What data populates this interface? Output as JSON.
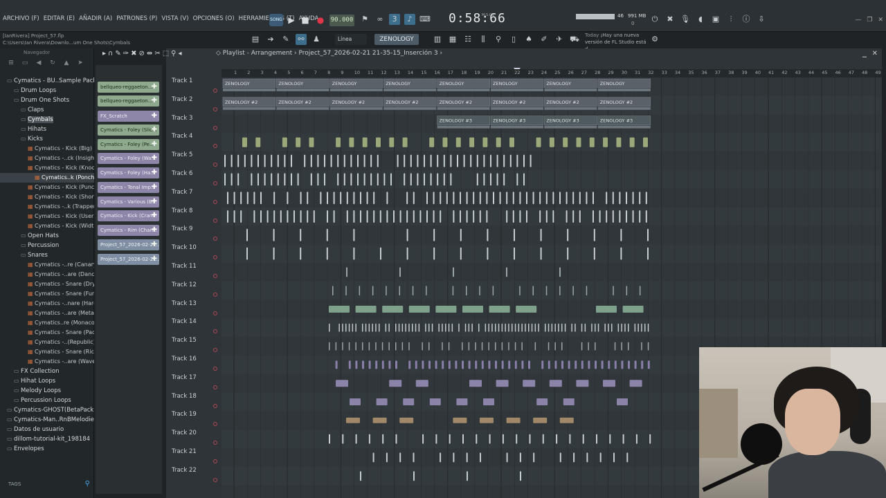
{
  "menu": [
    "ARCHIVO (F)",
    "EDITAR (E)",
    "AÑADIR (A)",
    "PATRONES (P)",
    "VISTA (V)",
    "OPCIONES (O)",
    "HERRAMIENTAS (T)",
    "AYUDA"
  ],
  "hint": {
    "line1": "[IanRivera] Project_57.flp",
    "line2": "C:\\Users\\Ian Rivera\\Downlo...um One Shots\\Cymbals"
  },
  "transport": {
    "song_label": "SONG",
    "tempo": "90.000",
    "time": "0:58:66",
    "time_sub": "M:S:CS"
  },
  "cpu": {
    "value": "46",
    "mem": "991 MB",
    "mem2": "0"
  },
  "toolbar": {
    "snap": "Línea",
    "pattern": "ZENOLOGY"
  },
  "news": {
    "today": "Today",
    "text": "¡Hay una nueva versión de FL Studio está d..."
  },
  "browser": {
    "header": "Navegador",
    "tree": [
      {
        "label": "Cymatics - BU..Sample Pack",
        "level": 0,
        "kind": "folder"
      },
      {
        "label": "Drum Loops",
        "level": 1,
        "kind": "folder"
      },
      {
        "label": "Drum One Shots",
        "level": 1,
        "kind": "folder"
      },
      {
        "label": "Claps",
        "level": 2,
        "kind": "folder"
      },
      {
        "label": "Cymbals",
        "level": 2,
        "kind": "folder",
        "selected": true
      },
      {
        "label": "Hihats",
        "level": 2,
        "kind": "folder"
      },
      {
        "label": "Kicks",
        "level": 2,
        "kind": "folder"
      },
      {
        "label": "Cymatics - Kick (Big)",
        "level": 3,
        "kind": "file"
      },
      {
        "label": "Cymatics -..ck (Insight)",
        "level": 3,
        "kind": "file"
      },
      {
        "label": "Cymatics - Kick (Knock)",
        "level": 3,
        "kind": "file"
      },
      {
        "label": "Cymatics..k (Ponche)",
        "level": 4,
        "kind": "file",
        "selected": true
      },
      {
        "label": "Cymatics - Kick (Punch)",
        "level": 3,
        "kind": "file"
      },
      {
        "label": "Cymatics - Kick (Short)",
        "level": 3,
        "kind": "file"
      },
      {
        "label": "Cymatics -..k (Trapper)",
        "level": 3,
        "kind": "file"
      },
      {
        "label": "Cymatics - Kick (User)",
        "level": 3,
        "kind": "file"
      },
      {
        "label": "Cymatics - Kick (Width)",
        "level": 3,
        "kind": "file"
      },
      {
        "label": "Open Hats",
        "level": 2,
        "kind": "folder"
      },
      {
        "label": "Percussion",
        "level": 2,
        "kind": "folder"
      },
      {
        "label": "Snares",
        "level": 2,
        "kind": "folder"
      },
      {
        "label": "Cymatics -..re (Canary)",
        "level": 3,
        "kind": "file"
      },
      {
        "label": "Cymatics -..are (Dance)",
        "level": 3,
        "kind": "file"
      },
      {
        "label": "Cymatics - Snare (Dry)",
        "level": 3,
        "kind": "file"
      },
      {
        "label": "Cymatics - Snare (Fun)",
        "level": 3,
        "kind": "file"
      },
      {
        "label": "Cymatics -..nare (Hard)",
        "level": 3,
        "kind": "file"
      },
      {
        "label": "Cymatics -..are (Metal)",
        "level": 3,
        "kind": "file"
      },
      {
        "label": "Cymatics..re (Monaco)",
        "level": 3,
        "kind": "file"
      },
      {
        "label": "Cymatics - Snare (Pack)",
        "level": 3,
        "kind": "file"
      },
      {
        "label": "Cymatics -..(Republic)",
        "level": 3,
        "kind": "file"
      },
      {
        "label": "Cymatics - Snare (Rico)",
        "level": 3,
        "kind": "file"
      },
      {
        "label": "Cymatics -..are (Waves)",
        "level": 3,
        "kind": "file"
      },
      {
        "label": "FX Collection",
        "level": 1,
        "kind": "folder"
      },
      {
        "label": "Hihat Loops",
        "level": 1,
        "kind": "folder"
      },
      {
        "label": "Melody Loops",
        "level": 1,
        "kind": "folder"
      },
      {
        "label": "Percussion Loops",
        "level": 1,
        "kind": "folder"
      },
      {
        "label": "Cymatics-GHOST(BetaPack)",
        "level": 0,
        "kind": "folder"
      },
      {
        "label": "Cymatics-Man..RnBMelodies",
        "level": 0,
        "kind": "folder"
      },
      {
        "label": "Datos de usuario",
        "level": 0,
        "kind": "folder"
      },
      {
        "label": "dillom-tutorial-kit_198184",
        "level": 0,
        "kind": "folder"
      },
      {
        "label": "Envelopes",
        "level": 0,
        "kind": "folder"
      }
    ],
    "footer": "TAGS"
  },
  "picker": [
    {
      "label": "bellqueo-reggaeton...",
      "color": "green"
    },
    {
      "label": "bellqueo-reggaeton...",
      "color": "green"
    },
    {
      "label": "FX_Scratch",
      "color": "purple"
    },
    {
      "label": "Cymatics - Foley (Slic...",
      "color": "green"
    },
    {
      "label": "Cymatics - Foley (Pe...",
      "color": "green"
    },
    {
      "label": "Cymatics - Foley (Wa...",
      "color": "purple"
    },
    {
      "label": "Cymatics - Foley (Ha...",
      "color": "purple"
    },
    {
      "label": "Cymatics - Tonal Imp...",
      "color": "purple"
    },
    {
      "label": "Cymatics - Various (B...",
      "color": "purple"
    },
    {
      "label": "Cymatics - Kick (Cran...",
      "color": "purple"
    },
    {
      "label": "Cymatics - Rim (Chan...",
      "color": "purple"
    },
    {
      "label": "Project_57_2026-02-21...",
      "color": "blue"
    },
    {
      "label": "Project_57_2026-02-21...",
      "color": "blue"
    }
  ],
  "playlist": {
    "title": "Playlist - Arrangement",
    "pattern": "Project_57_2026-02-21 21-35-15_Inserción 3",
    "bars": [
      "1",
      "2",
      "3",
      "4",
      "5",
      "6",
      "7",
      "8",
      "9",
      "10",
      "11",
      "12",
      "13",
      "14",
      "15",
      "16",
      "17",
      "18",
      "19",
      "20",
      "21",
      "22",
      "23",
      "24",
      "25",
      "26",
      "27",
      "28",
      "29",
      "30",
      "31",
      "32",
      "33",
      "34",
      "35",
      "36",
      "37",
      "38",
      "39",
      "40",
      "41",
      "42",
      "43",
      "44",
      "45",
      "46",
      "47",
      "48",
      "49"
    ],
    "tracks": [
      "Track 1",
      "Track 2",
      "Track 3",
      "Track 4",
      "Track 5",
      "Track 6",
      "Track 7",
      "Track 8",
      "Track 9",
      "Track 10",
      "Track 11",
      "Track 12",
      "Track 13",
      "Track 14",
      "Track 15",
      "Track 16",
      "Track 17",
      "Track 18",
      "Track 19",
      "Track 20",
      "Track 21",
      "Track 22"
    ],
    "clip_labels": {
      "t1": "ZENOLOGY",
      "t2": "ZENOLOGY #2",
      "t3": "ZENOLOGY #3"
    }
  }
}
